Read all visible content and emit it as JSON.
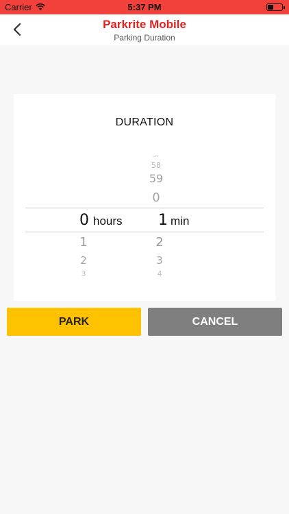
{
  "status_bar": {
    "carrier": "Carrier",
    "time": "5:37 PM",
    "icons": [
      "wifi-icon",
      "battery-icon"
    ]
  },
  "header": {
    "title": "Parkrite Mobile",
    "subtitle": "Parking Duration",
    "back_icon": "chevron-left-icon"
  },
  "duration": {
    "title": "DURATION",
    "hours": {
      "above": [],
      "selected": "0",
      "below": [
        "1",
        "2",
        "3"
      ],
      "unit": "hours"
    },
    "minutes": {
      "above": [
        "57",
        "58",
        "59",
        "0"
      ],
      "selected": "1",
      "below": [
        "2",
        "3",
        "4"
      ],
      "unit": "min"
    }
  },
  "buttons": {
    "park": "PARK",
    "cancel": "CANCEL"
  },
  "colors": {
    "status_bar": "#f2413a",
    "title": "#e02321",
    "park": "#ffc200",
    "cancel": "#7f7f7f"
  }
}
